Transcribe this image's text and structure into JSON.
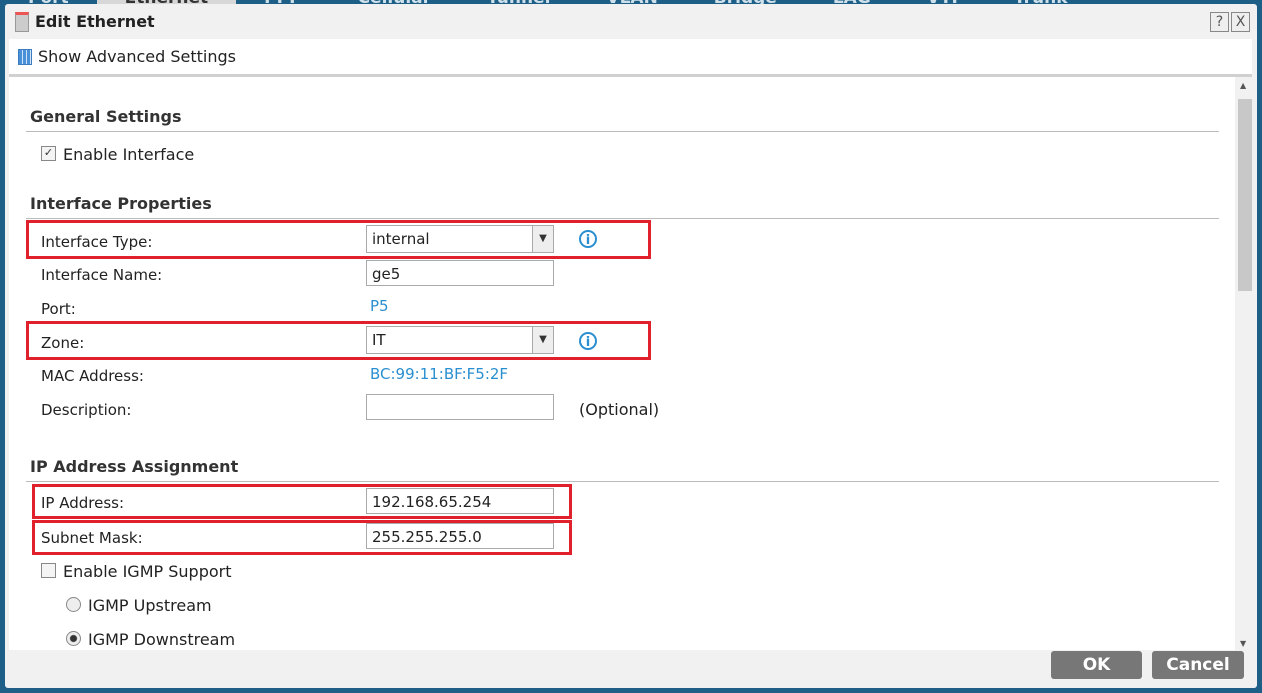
{
  "background_tabs": [
    "Port",
    "Ethernet",
    "PPP",
    "Cellular",
    "Tunnel",
    "VLAN",
    "Bridge",
    "LAG",
    "VTI",
    "Trunk"
  ],
  "dialog": {
    "title": "Edit Ethernet",
    "help": "?",
    "close": "X"
  },
  "toolbar": {
    "show_advanced": "Show Advanced Settings"
  },
  "general": {
    "heading": "General Settings",
    "enable_interface": "Enable Interface",
    "enable_checked": true
  },
  "props": {
    "heading": "Interface Properties",
    "type_label": "Interface Type:",
    "type_value": "internal",
    "name_label": "Interface Name:",
    "name_value": "ge5",
    "port_label": "Port:",
    "port_value": "P5",
    "zone_label": "Zone:",
    "zone_value": "IT",
    "mac_label": "MAC Address:",
    "mac_value": "BC:99:11:BF:F5:2F",
    "desc_label": "Description:",
    "desc_value": "",
    "desc_hint": "(Optional)"
  },
  "ip": {
    "heading": "IP Address Assignment",
    "ip_label": "IP Address:",
    "ip_value": "192.168.65.254",
    "mask_label": "Subnet Mask:",
    "mask_value": "255.255.255.0",
    "igmp": "Enable IGMP Support",
    "igmp_checked": false,
    "upstream": "IGMP Upstream",
    "downstream": "IGMP Downstream",
    "selected": "IGMP Downstream"
  },
  "footer": {
    "ok": "OK",
    "cancel": "Cancel"
  },
  "colors": {
    "highlight": "#e0202a",
    "link": "#2a8fd0",
    "button": "#777777"
  }
}
